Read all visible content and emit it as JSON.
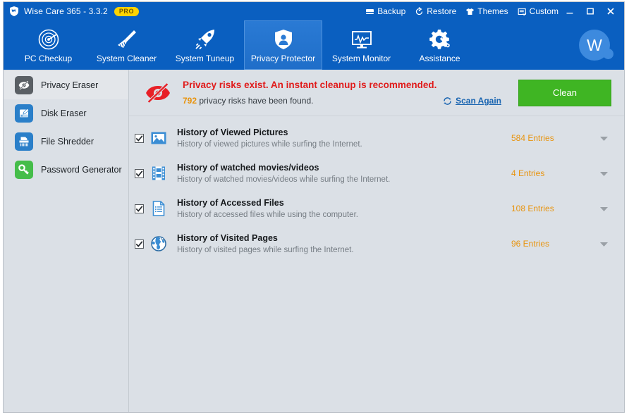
{
  "window": {
    "title": "Wise Care 365 - 3.3.2",
    "badge": "PRO",
    "logo_icon": "shield-icon"
  },
  "header": {
    "links": [
      {
        "label": "Backup",
        "icon": "backup-icon"
      },
      {
        "label": "Restore",
        "icon": "restore-icon"
      },
      {
        "label": "Themes",
        "icon": "themes-icon"
      },
      {
        "label": "Custom",
        "icon": "custom-icon"
      }
    ],
    "controls": [
      {
        "name": "minimize-button",
        "icon": "minimize-icon"
      },
      {
        "name": "maximize-button",
        "icon": "maximize-icon"
      },
      {
        "name": "close-button",
        "icon": "close-icon"
      }
    ]
  },
  "nav": {
    "items": [
      {
        "label": "PC Checkup",
        "icon": "radar-icon",
        "active": false
      },
      {
        "label": "System Cleaner",
        "icon": "broom-icon",
        "active": false
      },
      {
        "label": "System Tuneup",
        "icon": "rocket-icon",
        "active": false
      },
      {
        "label": "Privacy Protector",
        "icon": "shield-person-icon",
        "active": true
      },
      {
        "label": "System Monitor",
        "icon": "monitor-icon",
        "active": false
      },
      {
        "label": "Assistance",
        "icon": "gear-wrench-icon",
        "active": false
      }
    ],
    "avatar_letter": "W"
  },
  "sidebar": {
    "items": [
      {
        "label": "Privacy Eraser",
        "icon": "eye-off-icon",
        "color": "#5a5f64",
        "active": true
      },
      {
        "label": "Disk Eraser",
        "icon": "disk-icon",
        "color": "#2a7fc9",
        "active": false
      },
      {
        "label": "File Shredder",
        "icon": "shredder-icon",
        "color": "#2a7fc9",
        "active": false
      },
      {
        "label": "Password Generator",
        "icon": "key-icon",
        "color": "#45bd4a",
        "active": false
      }
    ]
  },
  "banner": {
    "icon": "privacy-risk-icon",
    "title": "Privacy risks exist. An instant cleanup is recommended.",
    "risk_count": "792",
    "subtitle_rest": "privacy risks have been found.",
    "scan_again_label": "Scan Again",
    "scan_again_icon": "refresh-icon",
    "clean_label": "Clean",
    "title_color": "#e01b1b",
    "count_color": "#e8930c",
    "clean_color": "#3fb523"
  },
  "list": {
    "rows": [
      {
        "title": "History of Viewed Pictures",
        "desc": "History of viewed pictures while surfing the Internet.",
        "count": "584 Entries",
        "icon": "picture-icon",
        "checked": true
      },
      {
        "title": "History of watched movies/videos",
        "desc": "History of watched movies/videos while surfing the Internet.",
        "count": "4 Entries",
        "icon": "film-icon",
        "checked": true
      },
      {
        "title": "History of Accessed Files",
        "desc": "History of accessed files while using the computer.",
        "count": "108 Entries",
        "icon": "document-icon",
        "checked": true
      },
      {
        "title": "History of Visited Pages",
        "desc": "History of visited pages while surfing the Internet.",
        "count": "96 Entries",
        "icon": "globe-icon",
        "checked": true
      }
    ]
  }
}
